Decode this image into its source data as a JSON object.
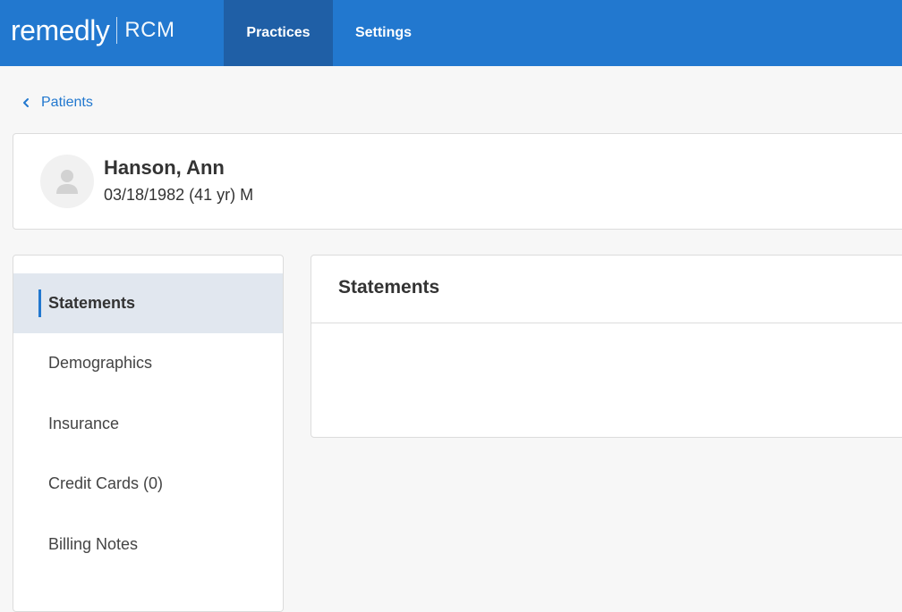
{
  "header": {
    "logo_word": "remedly",
    "logo_sub": "RCM",
    "tabs": [
      {
        "label": "Practices",
        "active": true
      },
      {
        "label": "Settings",
        "active": false
      }
    ]
  },
  "breadcrumb": {
    "back_label": "Patients",
    "icon": "chevron-left-icon"
  },
  "patient": {
    "name": "Hanson, Ann",
    "details": "03/18/1982 (41 yr) M",
    "avatar_icon": "user-placeholder-icon"
  },
  "sidenav": {
    "items": [
      {
        "label": "Statements",
        "active": true
      },
      {
        "label": "Demographics",
        "active": false
      },
      {
        "label": "Insurance",
        "active": false
      },
      {
        "label": "Credit Cards (0)",
        "active": false
      },
      {
        "label": "Billing Notes",
        "active": false
      }
    ]
  },
  "main": {
    "title": "Statements"
  },
  "colors": {
    "brand_blue": "#2278cf",
    "active_tab": "#1f5fa6",
    "active_nav_bg": "#e1e7ef"
  }
}
